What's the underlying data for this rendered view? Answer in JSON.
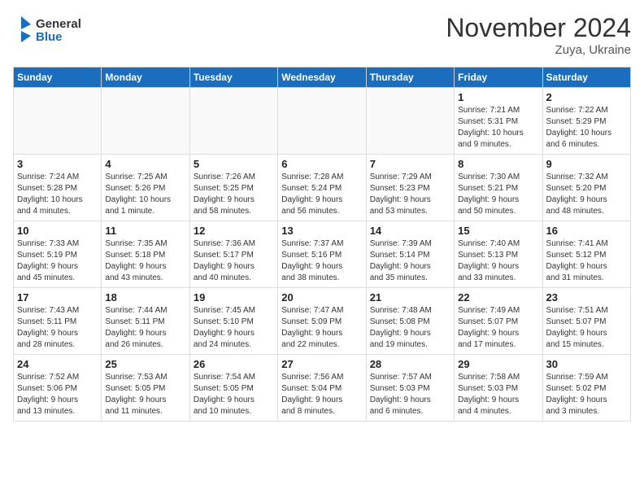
{
  "header": {
    "logo_line1": "General",
    "logo_line2": "Blue",
    "month": "November 2024",
    "location": "Zuya, Ukraine"
  },
  "weekdays": [
    "Sunday",
    "Monday",
    "Tuesday",
    "Wednesday",
    "Thursday",
    "Friday",
    "Saturday"
  ],
  "weeks": [
    [
      {
        "day": "",
        "info": ""
      },
      {
        "day": "",
        "info": ""
      },
      {
        "day": "",
        "info": ""
      },
      {
        "day": "",
        "info": ""
      },
      {
        "day": "",
        "info": ""
      },
      {
        "day": "1",
        "info": "Sunrise: 7:21 AM\nSunset: 5:31 PM\nDaylight: 10 hours\nand 9 minutes."
      },
      {
        "day": "2",
        "info": "Sunrise: 7:22 AM\nSunset: 5:29 PM\nDaylight: 10 hours\nand 6 minutes."
      }
    ],
    [
      {
        "day": "3",
        "info": "Sunrise: 7:24 AM\nSunset: 5:28 PM\nDaylight: 10 hours\nand 4 minutes."
      },
      {
        "day": "4",
        "info": "Sunrise: 7:25 AM\nSunset: 5:26 PM\nDaylight: 10 hours\nand 1 minute."
      },
      {
        "day": "5",
        "info": "Sunrise: 7:26 AM\nSunset: 5:25 PM\nDaylight: 9 hours\nand 58 minutes."
      },
      {
        "day": "6",
        "info": "Sunrise: 7:28 AM\nSunset: 5:24 PM\nDaylight: 9 hours\nand 56 minutes."
      },
      {
        "day": "7",
        "info": "Sunrise: 7:29 AM\nSunset: 5:23 PM\nDaylight: 9 hours\nand 53 minutes."
      },
      {
        "day": "8",
        "info": "Sunrise: 7:30 AM\nSunset: 5:21 PM\nDaylight: 9 hours\nand 50 minutes."
      },
      {
        "day": "9",
        "info": "Sunrise: 7:32 AM\nSunset: 5:20 PM\nDaylight: 9 hours\nand 48 minutes."
      }
    ],
    [
      {
        "day": "10",
        "info": "Sunrise: 7:33 AM\nSunset: 5:19 PM\nDaylight: 9 hours\nand 45 minutes."
      },
      {
        "day": "11",
        "info": "Sunrise: 7:35 AM\nSunset: 5:18 PM\nDaylight: 9 hours\nand 43 minutes."
      },
      {
        "day": "12",
        "info": "Sunrise: 7:36 AM\nSunset: 5:17 PM\nDaylight: 9 hours\nand 40 minutes."
      },
      {
        "day": "13",
        "info": "Sunrise: 7:37 AM\nSunset: 5:16 PM\nDaylight: 9 hours\nand 38 minutes."
      },
      {
        "day": "14",
        "info": "Sunrise: 7:39 AM\nSunset: 5:14 PM\nDaylight: 9 hours\nand 35 minutes."
      },
      {
        "day": "15",
        "info": "Sunrise: 7:40 AM\nSunset: 5:13 PM\nDaylight: 9 hours\nand 33 minutes."
      },
      {
        "day": "16",
        "info": "Sunrise: 7:41 AM\nSunset: 5:12 PM\nDaylight: 9 hours\nand 31 minutes."
      }
    ],
    [
      {
        "day": "17",
        "info": "Sunrise: 7:43 AM\nSunset: 5:11 PM\nDaylight: 9 hours\nand 28 minutes."
      },
      {
        "day": "18",
        "info": "Sunrise: 7:44 AM\nSunset: 5:11 PM\nDaylight: 9 hours\nand 26 minutes."
      },
      {
        "day": "19",
        "info": "Sunrise: 7:45 AM\nSunset: 5:10 PM\nDaylight: 9 hours\nand 24 minutes."
      },
      {
        "day": "20",
        "info": "Sunrise: 7:47 AM\nSunset: 5:09 PM\nDaylight: 9 hours\nand 22 minutes."
      },
      {
        "day": "21",
        "info": "Sunrise: 7:48 AM\nSunset: 5:08 PM\nDaylight: 9 hours\nand 19 minutes."
      },
      {
        "day": "22",
        "info": "Sunrise: 7:49 AM\nSunset: 5:07 PM\nDaylight: 9 hours\nand 17 minutes."
      },
      {
        "day": "23",
        "info": "Sunrise: 7:51 AM\nSunset: 5:07 PM\nDaylight: 9 hours\nand 15 minutes."
      }
    ],
    [
      {
        "day": "24",
        "info": "Sunrise: 7:52 AM\nSunset: 5:06 PM\nDaylight: 9 hours\nand 13 minutes."
      },
      {
        "day": "25",
        "info": "Sunrise: 7:53 AM\nSunset: 5:05 PM\nDaylight: 9 hours\nand 11 minutes."
      },
      {
        "day": "26",
        "info": "Sunrise: 7:54 AM\nSunset: 5:05 PM\nDaylight: 9 hours\nand 10 minutes."
      },
      {
        "day": "27",
        "info": "Sunrise: 7:56 AM\nSunset: 5:04 PM\nDaylight: 9 hours\nand 8 minutes."
      },
      {
        "day": "28",
        "info": "Sunrise: 7:57 AM\nSunset: 5:03 PM\nDaylight: 9 hours\nand 6 minutes."
      },
      {
        "day": "29",
        "info": "Sunrise: 7:58 AM\nSunset: 5:03 PM\nDaylight: 9 hours\nand 4 minutes."
      },
      {
        "day": "30",
        "info": "Sunrise: 7:59 AM\nSunset: 5:02 PM\nDaylight: 9 hours\nand 3 minutes."
      }
    ]
  ]
}
